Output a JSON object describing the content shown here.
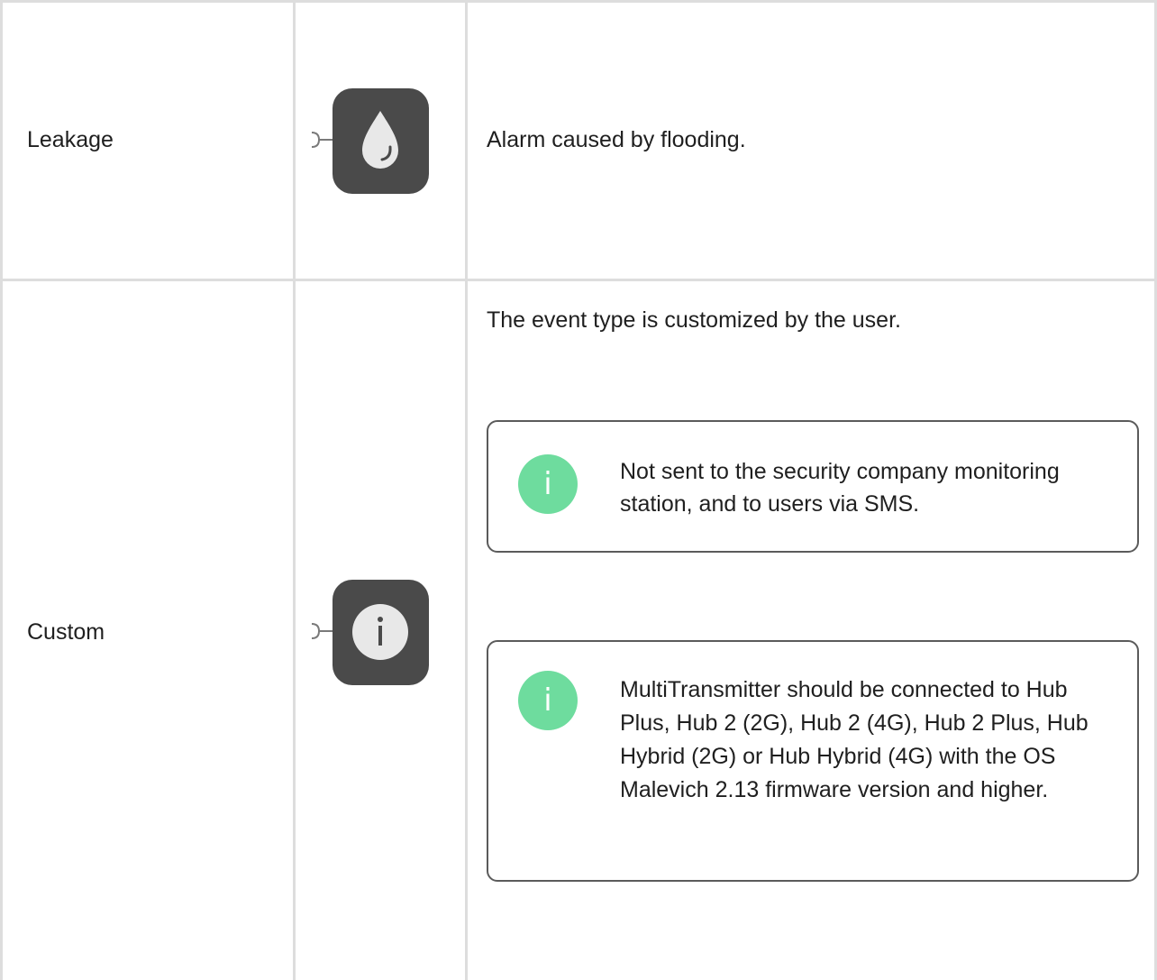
{
  "rows": [
    {
      "event": "Leakage",
      "icon": "water-drop-icon",
      "description": "Alarm caused by flooding."
    },
    {
      "event": "Custom",
      "icon": "info-icon",
      "description": "The event type is customized by the user.",
      "notes": [
        {
          "badge": "i",
          "text": "Not sent to the security company monitoring station, and to users via SMS."
        },
        {
          "badge": "i",
          "text": "MultiTransmitter should be connected to Hub Plus, Hub 2 (2G), Hub 2 (4G), Hub 2 Plus, Hub Hybrid (2G) or Hub Hybrid (4G) with the OS Malevich 2.13 firmware version and higher."
        }
      ]
    }
  ],
  "colors": {
    "grid": "#dddddd",
    "icon_tile": "#4a4a4a",
    "note_badge": "#6edc9e",
    "note_border": "#5b5b5b"
  }
}
